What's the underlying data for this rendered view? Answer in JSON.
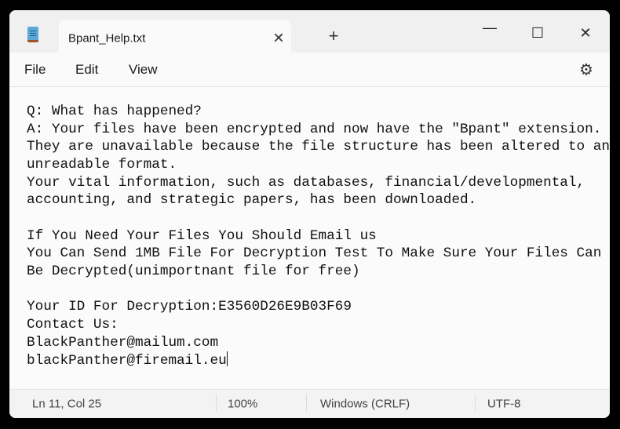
{
  "window": {
    "tab_title": "Bpant_Help.txt"
  },
  "menu": {
    "items": [
      "File",
      "Edit",
      "View"
    ]
  },
  "icons": {
    "app": "notepad-icon",
    "close_tab": "close-icon",
    "new_tab": "plus-icon",
    "minimize": "minimize-icon",
    "maximize": "maximize-icon",
    "close": "close-icon",
    "settings": "gear-icon"
  },
  "editor": {
    "lines": [
      "Q: What has happened?",
      "A: Your files have been encrypted and now have the \"Bpant\" extension.",
      "They are unavailable because the file structure has been altered to an",
      "unreadable format.",
      "Your vital information, such as databases, financial/developmental,",
      "accounting, and strategic papers, has been downloaded.",
      "",
      "If You Need Your Files You Should Email us",
      "You Can Send 1MB File For Decryption Test To Make Sure Your Files Can",
      "Be Decrypted(unimportnant file for free)",
      "",
      "Your ID For Decryption:E3560D26E9B03F69",
      "Contact Us:",
      "BlackPanther@mailum.com",
      "blackPanther@firemail.eu"
    ]
  },
  "status": {
    "position": "Ln 11, Col 25",
    "zoom": "100%",
    "line_ending": "Windows (CRLF)",
    "encoding": "UTF-8"
  }
}
